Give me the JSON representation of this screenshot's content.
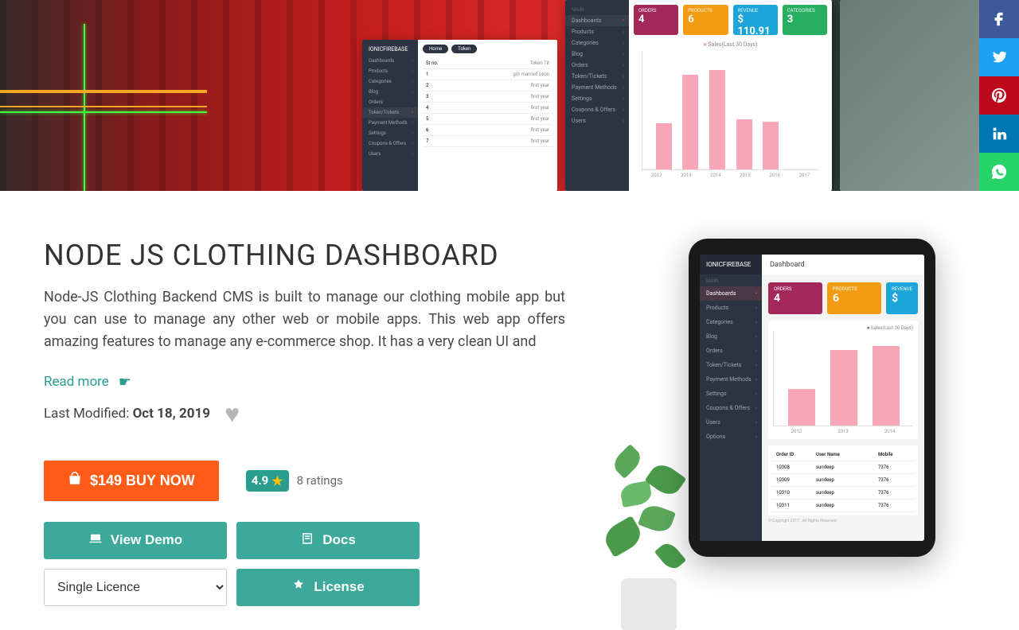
{
  "product": {
    "title": "NODE JS CLOTHING DASHBOARD",
    "description": "Node-JS Clothing Backend CMS is built to manage our clothing mobile app but you can use to manage any other web or mobile apps. This web app offers amazing features to manage any e-commerce shop. It has a very clean UI and",
    "read_more": "Read more",
    "last_modified_label": "Last Modified: ",
    "last_modified_date": "Oct 18, 2019"
  },
  "buy": {
    "label": "$149 BUY NOW",
    "rating_score": "4.9",
    "ratings_count": "8 ratings"
  },
  "buttons": {
    "demo": "View Demo",
    "docs": "Docs",
    "license_select": "Single Licence",
    "license": "License"
  },
  "hero_dash": {
    "logo": "IONICFIREBASE",
    "sidebar": [
      "Dashboards",
      "Products",
      "Categories",
      "Blog",
      "Orders",
      "Token/Tickets",
      "Payment Methods",
      "Settings",
      "Coupons & Offers",
      "Users"
    ],
    "tabs": [
      "Home",
      "Token"
    ],
    "table_header": "Sr no.",
    "table_rows": [
      "1",
      "2",
      "3",
      "4",
      "5",
      "6",
      "7"
    ]
  },
  "hero_dash2": {
    "section": "MAIN",
    "sidebar": [
      "Dashboards",
      "Products",
      "Categories",
      "Blog",
      "Orders",
      "Token/Tickets",
      "Payment Methods",
      "Settings",
      "Coupons & Offers",
      "Users"
    ],
    "cards": [
      {
        "label": "ORDERS",
        "value": "4"
      },
      {
        "label": "PRODUCTS",
        "value": "6"
      },
      {
        "label": "REVENUE",
        "value": "$ 110.91"
      },
      {
        "label": "CATEGORIES",
        "value": "3"
      }
    ],
    "legend": "Sales(Last 30 Days)"
  },
  "tablet": {
    "logo": "IONICFIREBASE",
    "header": "Dashboard",
    "section": "MAIN",
    "sidebar": [
      "Dashboards",
      "Products",
      "Categories",
      "Blog",
      "Orders",
      "Token/Tickets",
      "Payment Methods",
      "Settings",
      "Coupons & Offers",
      "Users",
      "Options"
    ],
    "cards": [
      {
        "label": "ORDERS",
        "value": "4"
      },
      {
        "label": "PRODUCTS",
        "value": "6"
      },
      {
        "label": "REVENUE",
        "value": "$"
      }
    ],
    "table": {
      "headers": [
        "Order ID",
        "User Name",
        "Mobile"
      ],
      "rows": [
        [
          "10308",
          "sundeep",
          "7376"
        ],
        [
          "10309",
          "sundeep",
          "7376"
        ],
        [
          "10310",
          "sundeep",
          "7376"
        ],
        [
          "10311",
          "sundeep",
          "7376"
        ]
      ]
    },
    "footer": "© Copyright 2017 . All Rights Reserved"
  },
  "chart_data": {
    "type": "bar",
    "title": "Sales(Last 30 Days)",
    "categories": [
      "2012",
      "2013",
      "2014",
      "2015",
      "2016",
      "2017"
    ],
    "values": [
      35,
      72,
      76,
      38,
      36,
      0
    ],
    "ylim": [
      0,
      90
    ],
    "xlabel": "",
    "ylabel": ""
  },
  "tablet_chart": {
    "type": "bar",
    "categories": [
      "2012",
      "2013",
      "2014"
    ],
    "values": [
      35,
      72,
      76
    ],
    "ylim": [
      0,
      90
    ]
  }
}
